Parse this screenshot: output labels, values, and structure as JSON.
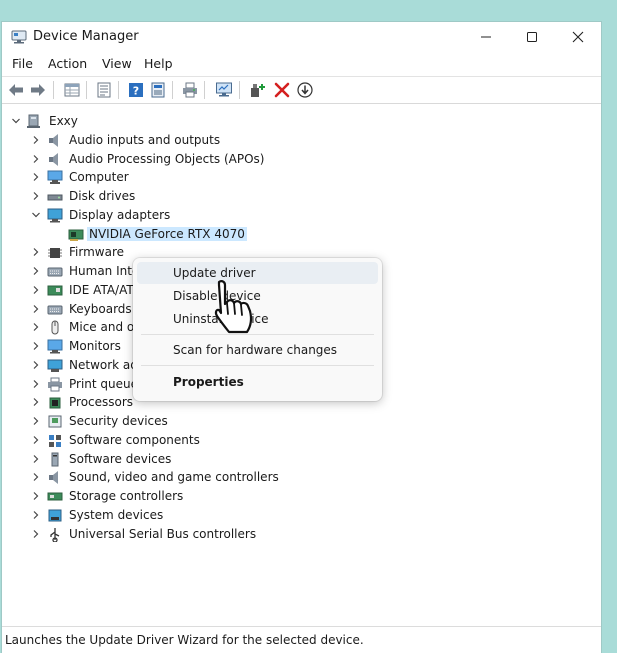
{
  "window": {
    "title": "Device Manager",
    "controls": {
      "minimize": "minimize",
      "maximize": "maximize",
      "close": "close"
    }
  },
  "menubar": {
    "items": [
      "File",
      "Action",
      "View",
      "Help"
    ]
  },
  "toolbar": {
    "icons": [
      "back-arrow-icon",
      "forward-arrow-icon",
      "properties-grid-icon",
      "update-list-icon",
      "help-icon",
      "device-panel-icon",
      "print-icon",
      "monitor-scan-icon",
      "add-driver-icon",
      "remove-x-icon",
      "download-circle-icon"
    ]
  },
  "tree": {
    "root": "Exxy",
    "categories": [
      {
        "label": "Audio inputs and outputs",
        "icon": "speaker-icon"
      },
      {
        "label": "Audio Processing Objects (APOs)",
        "icon": "speaker-icon"
      },
      {
        "label": "Computer",
        "icon": "computer-icon"
      },
      {
        "label": "Disk drives",
        "icon": "disk-drive-icon"
      },
      {
        "label": "Display adapters",
        "icon": "display-adapter-icon",
        "expanded": true,
        "children": [
          {
            "label": "NVIDIA GeForce RTX 4070",
            "icon": "gpu-card-icon",
            "selected": true
          }
        ]
      },
      {
        "label": "Firmware",
        "icon": "firmware-chip-icon"
      },
      {
        "label": "Human Inte",
        "icon": "keyboard-icon"
      },
      {
        "label": "IDE ATA/ATA",
        "icon": "ide-controller-icon"
      },
      {
        "label": "Keyboards",
        "icon": "keyboard-icon"
      },
      {
        "label": "Mice and o",
        "icon": "mouse-icon"
      },
      {
        "label": "Monitors",
        "icon": "monitor-icon"
      },
      {
        "label": "Network ad",
        "icon": "network-adapter-icon"
      },
      {
        "label": "Print queues",
        "icon": "printer-icon"
      },
      {
        "label": "Processors",
        "icon": "processor-icon"
      },
      {
        "label": "Security devices",
        "icon": "security-key-icon"
      },
      {
        "label": "Software components",
        "icon": "software-component-icon"
      },
      {
        "label": "Software devices",
        "icon": "software-device-icon"
      },
      {
        "label": "Sound, video and game controllers",
        "icon": "speaker-icon"
      },
      {
        "label": "Storage controllers",
        "icon": "storage-controller-icon"
      },
      {
        "label": "System devices",
        "icon": "system-devices-icon"
      },
      {
        "label": "Universal Serial Bus controllers",
        "icon": "usb-icon"
      }
    ]
  },
  "context_menu": {
    "items": [
      {
        "label": "Update driver",
        "hovered": true
      },
      {
        "label": "Disable device"
      },
      {
        "label": "Uninstall device"
      },
      {
        "label": "Scan for hardware changes"
      },
      {
        "label": "Properties",
        "bold": true
      }
    ]
  },
  "statusbar": {
    "text": "Launches the Update Driver Wizard for the selected device."
  },
  "colors": {
    "selection": "#cce8ff",
    "accent_blue": "#2b6fbf",
    "delete_red": "#d42020",
    "add_green": "#1f9a3a"
  }
}
